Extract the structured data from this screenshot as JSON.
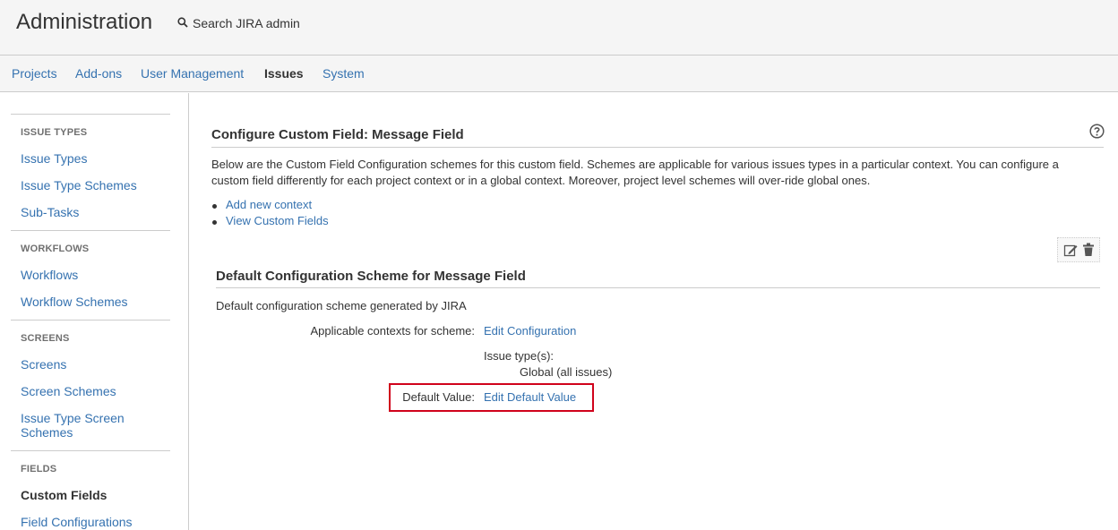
{
  "header": {
    "title": "Administration",
    "search_label": "Search JIRA admin"
  },
  "nav": {
    "tabs": [
      {
        "label": "Projects"
      },
      {
        "label": "Add-ons"
      },
      {
        "label": "User Management"
      },
      {
        "label": "Issues",
        "active": true
      },
      {
        "label": "System"
      }
    ]
  },
  "sidebar": {
    "sections": [
      {
        "heading": "ISSUE TYPES",
        "items": [
          "Issue Types",
          "Issue Type Schemes",
          "Sub-Tasks"
        ]
      },
      {
        "heading": "WORKFLOWS",
        "items": [
          "Workflows",
          "Workflow Schemes"
        ]
      },
      {
        "heading": "SCREENS",
        "items": [
          "Screens",
          "Screen Schemes",
          "Issue Type Screen Schemes"
        ]
      },
      {
        "heading": "FIELDS",
        "items": [
          "Custom Fields",
          "Field Configurations"
        ],
        "active": "Custom Fields"
      }
    ]
  },
  "main": {
    "title": "Configure Custom Field: Message Field",
    "description": "Below are the Custom Field Configuration schemes for this custom field. Schemes are applicable for various issues types in a particular context. You can configure a custom field differently for each project context or in a global context. Moreover, project level schemes will over-ride global ones.",
    "links": [
      "Add new context",
      "View Custom Fields"
    ],
    "scheme": {
      "title": "Default Configuration Scheme for Message Field",
      "description": "Default configuration scheme generated by JIRA",
      "contexts_label": "Applicable contexts for scheme:",
      "edit_configuration": "Edit Configuration",
      "issue_types_label": "Issue type(s):",
      "issue_types_value": "Global (all issues)",
      "default_value_label": "Default Value:",
      "edit_default_value": "Edit Default Value"
    }
  },
  "colors": {
    "link": "#3572b0",
    "highlight": "#d0021b"
  },
  "icons": [
    "search-icon",
    "help-icon",
    "edit-icon",
    "trash-icon"
  ]
}
